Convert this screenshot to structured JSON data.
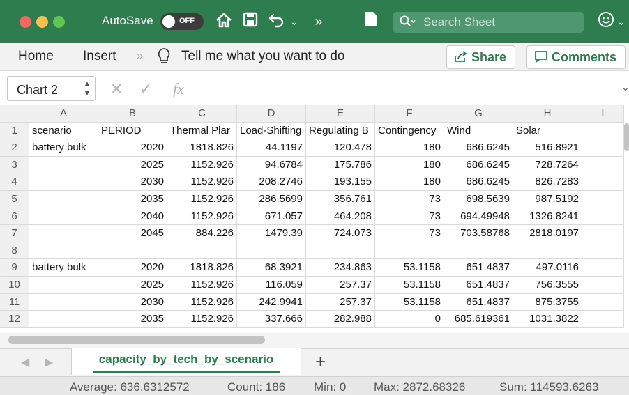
{
  "titlebar": {
    "autosave_label": "AutoSave",
    "autosave_state": "OFF",
    "search_placeholder": "Search Sheet"
  },
  "ribbon": {
    "tabs": [
      "Home",
      "Insert"
    ],
    "tell_me": "Tell me what you want to do",
    "share_label": "Share",
    "comments_label": "Comments"
  },
  "formula_bar": {
    "name_box": "Chart 2",
    "fx_label": "fx"
  },
  "grid": {
    "columns": [
      "A",
      "B",
      "C",
      "D",
      "E",
      "F",
      "G",
      "H",
      "I"
    ],
    "row_numbers": [
      "1",
      "2",
      "3",
      "4",
      "5",
      "6",
      "7",
      "8",
      "9",
      "10",
      "11",
      "12"
    ],
    "rows": [
      [
        "scenario",
        "PERIOD",
        "Thermal Plar",
        "Load-Shifting",
        "Regulating B",
        "Contingency",
        "Wind",
        "Solar",
        ""
      ],
      [
        "battery bulk",
        "2020",
        "1818.826",
        "44.1197",
        "120.478",
        "180",
        "686.6245",
        "516.8921",
        ""
      ],
      [
        "",
        "2025",
        "1152.926",
        "94.6784",
        "175.786",
        "180",
        "686.6245",
        "728.7264",
        ""
      ],
      [
        "",
        "2030",
        "1152.926",
        "208.2746",
        "193.155",
        "180",
        "686.6245",
        "826.7283",
        ""
      ],
      [
        "",
        "2035",
        "1152.926",
        "286.5699",
        "356.761",
        "73",
        "698.5639",
        "987.5192",
        ""
      ],
      [
        "",
        "2040",
        "1152.926",
        "671.057",
        "464.208",
        "73",
        "694.49948",
        "1326.8241",
        ""
      ],
      [
        "",
        "2045",
        "884.226",
        "1479.39",
        "724.073",
        "73",
        "703.58768",
        "2818.0197",
        ""
      ],
      [
        "",
        "",
        "",
        "",
        "",
        "",
        "",
        "",
        ""
      ],
      [
        "battery bulk",
        "2020",
        "1818.826",
        "68.3921",
        "234.863",
        "53.1158",
        "651.4837",
        "497.0116",
        ""
      ],
      [
        "",
        "2025",
        "1152.926",
        "116.059",
        "257.37",
        "53.1158",
        "651.4837",
        "756.3555",
        ""
      ],
      [
        "",
        "2030",
        "1152.926",
        "242.9941",
        "257.37",
        "53.1158",
        "651.4837",
        "875.3755",
        ""
      ],
      [
        "",
        "2035",
        "1152.926",
        "337.666",
        "282.988",
        "0",
        "685.619361",
        "1031.3822",
        ""
      ]
    ]
  },
  "sheets": {
    "active": "capacity_by_tech_by_scenario",
    "add_label": "+"
  },
  "status": {
    "average": "Average: 636.6312572",
    "count": "Count: 186",
    "min": "Min: 0",
    "max": "Max: 2872.68326",
    "sum": "Sum: 114593.6263"
  },
  "colors": {
    "brand_green": "#2e7d4f",
    "search_bg": "#4f9770"
  }
}
